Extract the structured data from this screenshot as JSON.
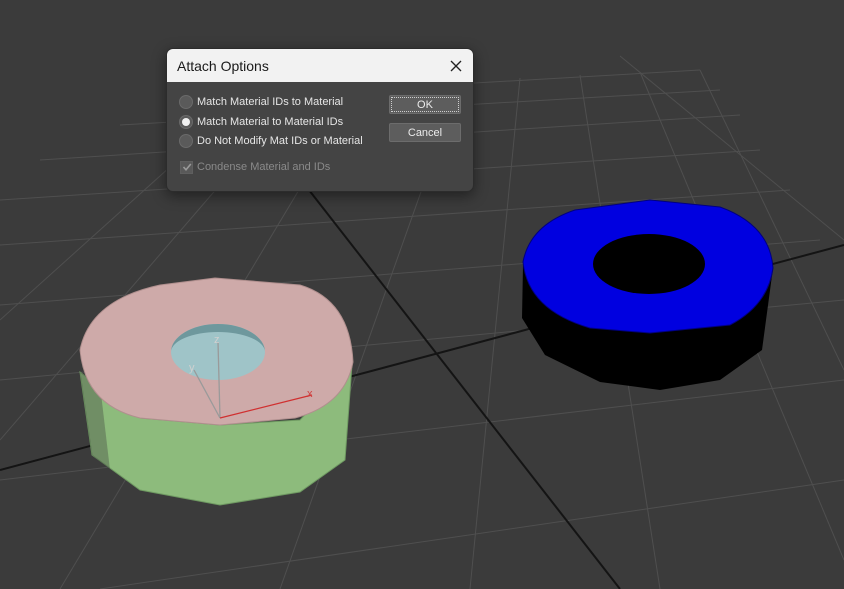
{
  "dialog": {
    "title": "Attach Options",
    "options": [
      {
        "label": "Match Material IDs to Material",
        "checked": false
      },
      {
        "label": "Match Material to Material IDs",
        "checked": true
      },
      {
        "label": "Do Not Modify Mat IDs or Material",
        "checked": false
      }
    ],
    "condense": {
      "label": "Condense Material and IDs",
      "checked": true,
      "enabled": false
    },
    "ok_label": "OK",
    "cancel_label": "Cancel"
  },
  "viewport": {
    "gizmo": {
      "x_label": "x",
      "y_label": "y",
      "z_label": "z"
    },
    "colors": {
      "background": "#3b3b3b",
      "grid": "#4d4d4d",
      "grid_axis": "#141414",
      "tube_top": "#ceaaa9",
      "tube_side": "#8dbb7c",
      "tube_inner": "#9fc4c8",
      "ring_top": "#0000e0",
      "ring_side": "#000000"
    },
    "icons": [
      "close-icon",
      "check-icon"
    ]
  }
}
